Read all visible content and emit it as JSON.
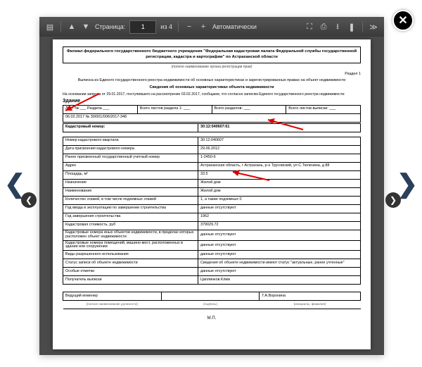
{
  "toolbar": {
    "page_label": "Страница:",
    "page_current": "1",
    "page_total": "из 4",
    "zoom_mode": "Автоматически"
  },
  "doc": {
    "header": "Филиал федерального государственного бюджетного учреждения \"Федеральная кадастровая палата Федеральной службы государственной регистрации, кадастра и картографии\" по Астраханской области",
    "sub_header": "(полное наименование органа регистрации прав)",
    "section": "Раздел 1",
    "intro1": "Выписка из Единого государственного реестра недвижимости об основных характеристиках и зарегистрированных правах на объект недвижимости",
    "intro2": "Сведения об основных характеристиках объекта недвижимости",
    "request_line": "На основании запроса от 29.01.2017, поступившего на рассмотрение 03.02.2017, сообщаем, что согласно записям Единого государственного реестра недвижимости:",
    "object_word": "Здание",
    "meta": {
      "sheet": "Лист № ___ Раздела ___",
      "sheets_section": "Всего листов раздела 1: ___",
      "sections": "Всего разделов: ___",
      "sheets_total": "Всего листов выписки: ___",
      "date_no": "06.02.2017 № 30/001/006/2017-348"
    },
    "cadastral_label": "Кадастровый номер:",
    "cadastral_value": "30:12:040607:61",
    "rows": [
      {
        "l": "Номер кадастрового квартала",
        "v": "30:12:040607"
      },
      {
        "l": "Дата присвоения кадастрового номера",
        "v": "29.06.2012"
      },
      {
        "l": "Ранее присвоенный государственный учетный номер",
        "v": "1-2450-6"
      },
      {
        "l": "Адрес",
        "v": "Астраханская область, г Астрахань, р-н Трусовский, ул С.Тюленина, д 88"
      },
      {
        "l": "Площадь, м²",
        "v": "33.5"
      },
      {
        "l": "Назначение",
        "v": "Жилой дом"
      },
      {
        "l": "Наименование",
        "v": "Жилой дом"
      },
      {
        "l": "Количество этажей, в том числе подземных этажей",
        "v": "1, а также подземных 0"
      },
      {
        "l": "Год ввода в эксплуатацию по завершении строительства",
        "v": "данные отсутствуют"
      },
      {
        "l": "Год завершения строительства",
        "v": "1962"
      },
      {
        "l": "Кадастровая стоимость, руб",
        "v": "379029.72"
      },
      {
        "l": "Кадастровые номера иных объектов недвижимости, в пределах которых расположен объект недвижимости",
        "v": "данные отсутствуют"
      },
      {
        "l": "Кадастровые номера помещений, машино-мест, расположенных в здании или сооружении",
        "v": "данные отсутствуют"
      },
      {
        "l": "Виды разрешенного использования",
        "v": "данные отсутствуют"
      },
      {
        "l": "Статус записи об объекте недвижимости",
        "v": "Сведения об объекте недвижимости имеют статус \"актуальные, ранее учтенные\""
      },
      {
        "l": "Особые отметки",
        "v": "данные отсутствуют"
      },
      {
        "l": "Получатель выписки",
        "v": "Цаплинков Клим"
      }
    ],
    "signer_role": "Ведущий инженер",
    "signer_name": "Т.А.Воронина",
    "mp": "М.П."
  }
}
